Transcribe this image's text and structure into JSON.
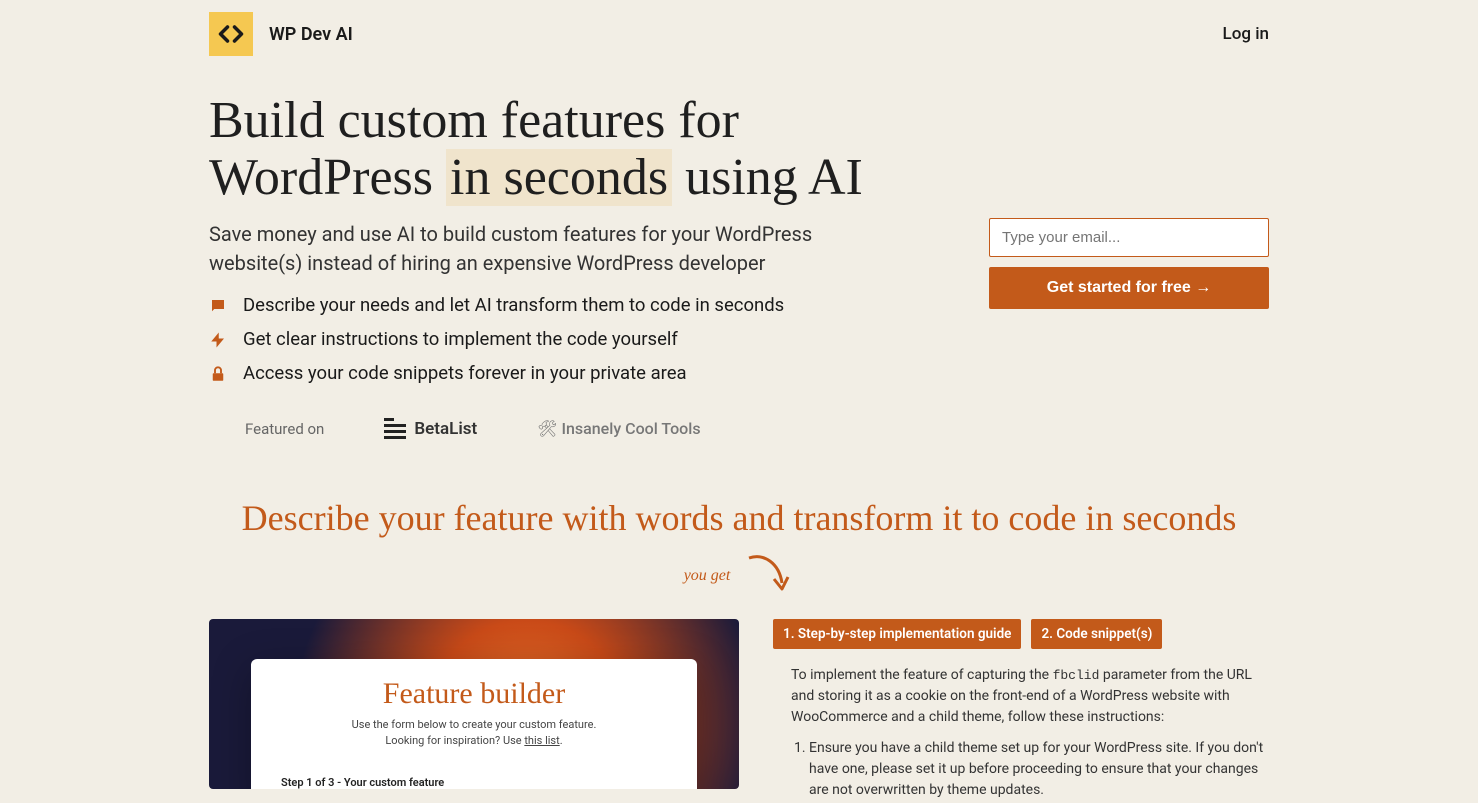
{
  "brand": "WP Dev AI",
  "login": "Log in",
  "hero": {
    "title_pre": "Build custom features for WordPress ",
    "title_highlight": "in seconds",
    "title_post": " using AI",
    "subtitle": "Save money and use AI to build custom features for your WordPress website(s) instead of hiring an expensive WordPress developer",
    "features": [
      "Describe your needs and let AI transform them to code in seconds",
      "Get clear instructions to implement the code yourself",
      "Access your code snippets forever in your private area"
    ]
  },
  "form": {
    "email_placeholder": "Type your email...",
    "cta": "Get started for free →"
  },
  "featured": {
    "label": "Featured on",
    "betalist": "BetaList",
    "tools": "🛠 Insanely Cool Tools"
  },
  "section": {
    "title": "Describe your feature with words and transform it to code in seconds",
    "you_get": "you get"
  },
  "pills": {
    "one": "1. Step-by-step implementation guide",
    "two": "2. Code snippet(s)"
  },
  "feature_builder": {
    "title": "Feature builder",
    "sub1": "Use the form below to create your custom feature.",
    "sub2_pre": "Looking for inspiration? Use ",
    "sub2_link": "this list",
    "sub2_post": ".",
    "step": "Step 1 of 3 - Your custom feature"
  },
  "guide": {
    "intro_pre": "To implement the feature of capturing the ",
    "intro_code": "fbclid",
    "intro_post": " parameter from the URL and storing it as a cookie on the front-end of a WordPress website with WooCommerce and a child theme, follow these instructions:",
    "step1": "Ensure you have a child theme set up for your WordPress site. If you don't have one, please set it up before proceeding to ensure that your changes are not overwritten by theme updates."
  }
}
